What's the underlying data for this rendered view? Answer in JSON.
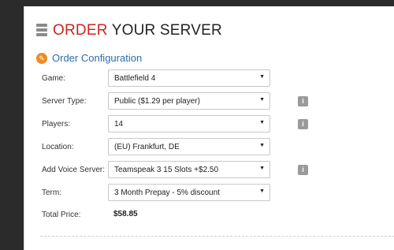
{
  "header": {
    "title_accent": "ORDER",
    "title_rest": " YOUR SERVER"
  },
  "section": {
    "title": "Order Configuration"
  },
  "form": {
    "game": {
      "label": "Game:",
      "value": "Battlefield 4"
    },
    "server_type": {
      "label": "Server Type:",
      "value": "Public ($1.29 per player)"
    },
    "players": {
      "label": "Players:",
      "value": "14"
    },
    "location": {
      "label": "Location:",
      "value": "(EU) Frankfurt, DE"
    },
    "voice": {
      "label": "Add Voice Server:",
      "value": "Teamspeak 3 15 Slots +$2.50"
    },
    "term": {
      "label": "Term:",
      "value": "3 Month Prepay - 5% discount"
    },
    "total": {
      "label": "Total Price:",
      "value": "$58.85"
    }
  },
  "icons": {
    "info": "i",
    "dropdown": "▼"
  },
  "colors": {
    "accent": "#c8271e",
    "section": "#2a6db0",
    "icon": "#f08a24"
  }
}
